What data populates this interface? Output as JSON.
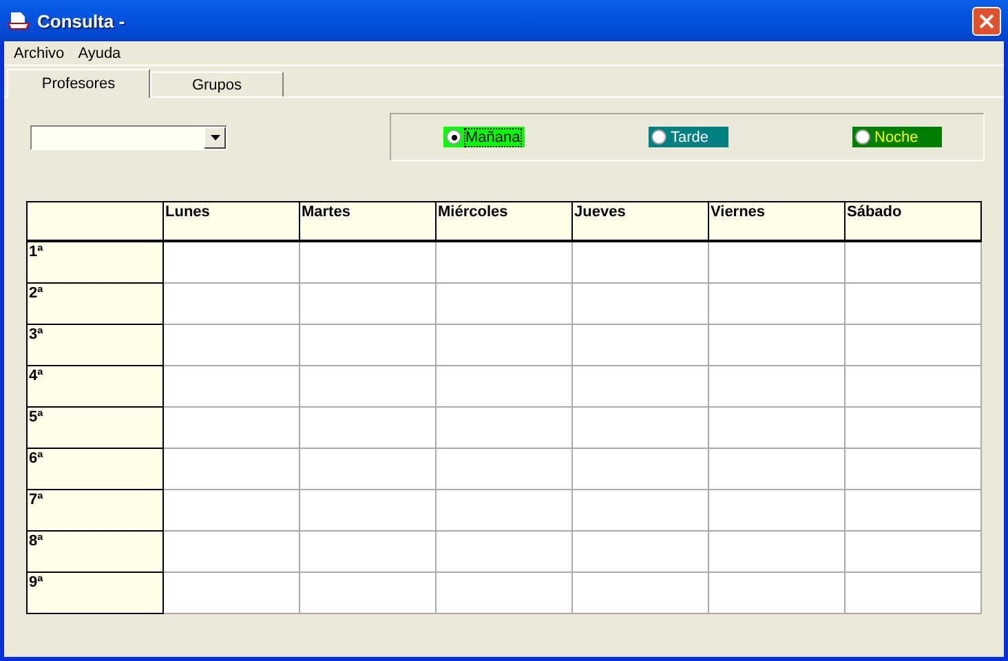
{
  "window": {
    "title": "Consulta  -"
  },
  "menu": [
    "Archivo",
    "Ayuda"
  ],
  "tabs": [
    {
      "label": "Profesores",
      "selected": true
    },
    {
      "label": "Grupos",
      "selected": false
    }
  ],
  "shifts": [
    {
      "label": "Mañana",
      "selected": true,
      "color": "#00ff00"
    },
    {
      "label": "Tarde",
      "selected": false,
      "color": "#008080"
    },
    {
      "label": "Noche",
      "selected": false,
      "color": "#008000"
    }
  ],
  "table": {
    "columns": [
      "Lunes",
      "Martes",
      "Miércoles",
      "Jueves",
      "Viernes",
      "Sábado"
    ],
    "rows": [
      "1ª",
      "2ª",
      "3ª",
      "4ª",
      "5ª",
      "6ª",
      "7ª",
      "8ª",
      "9ª"
    ]
  }
}
